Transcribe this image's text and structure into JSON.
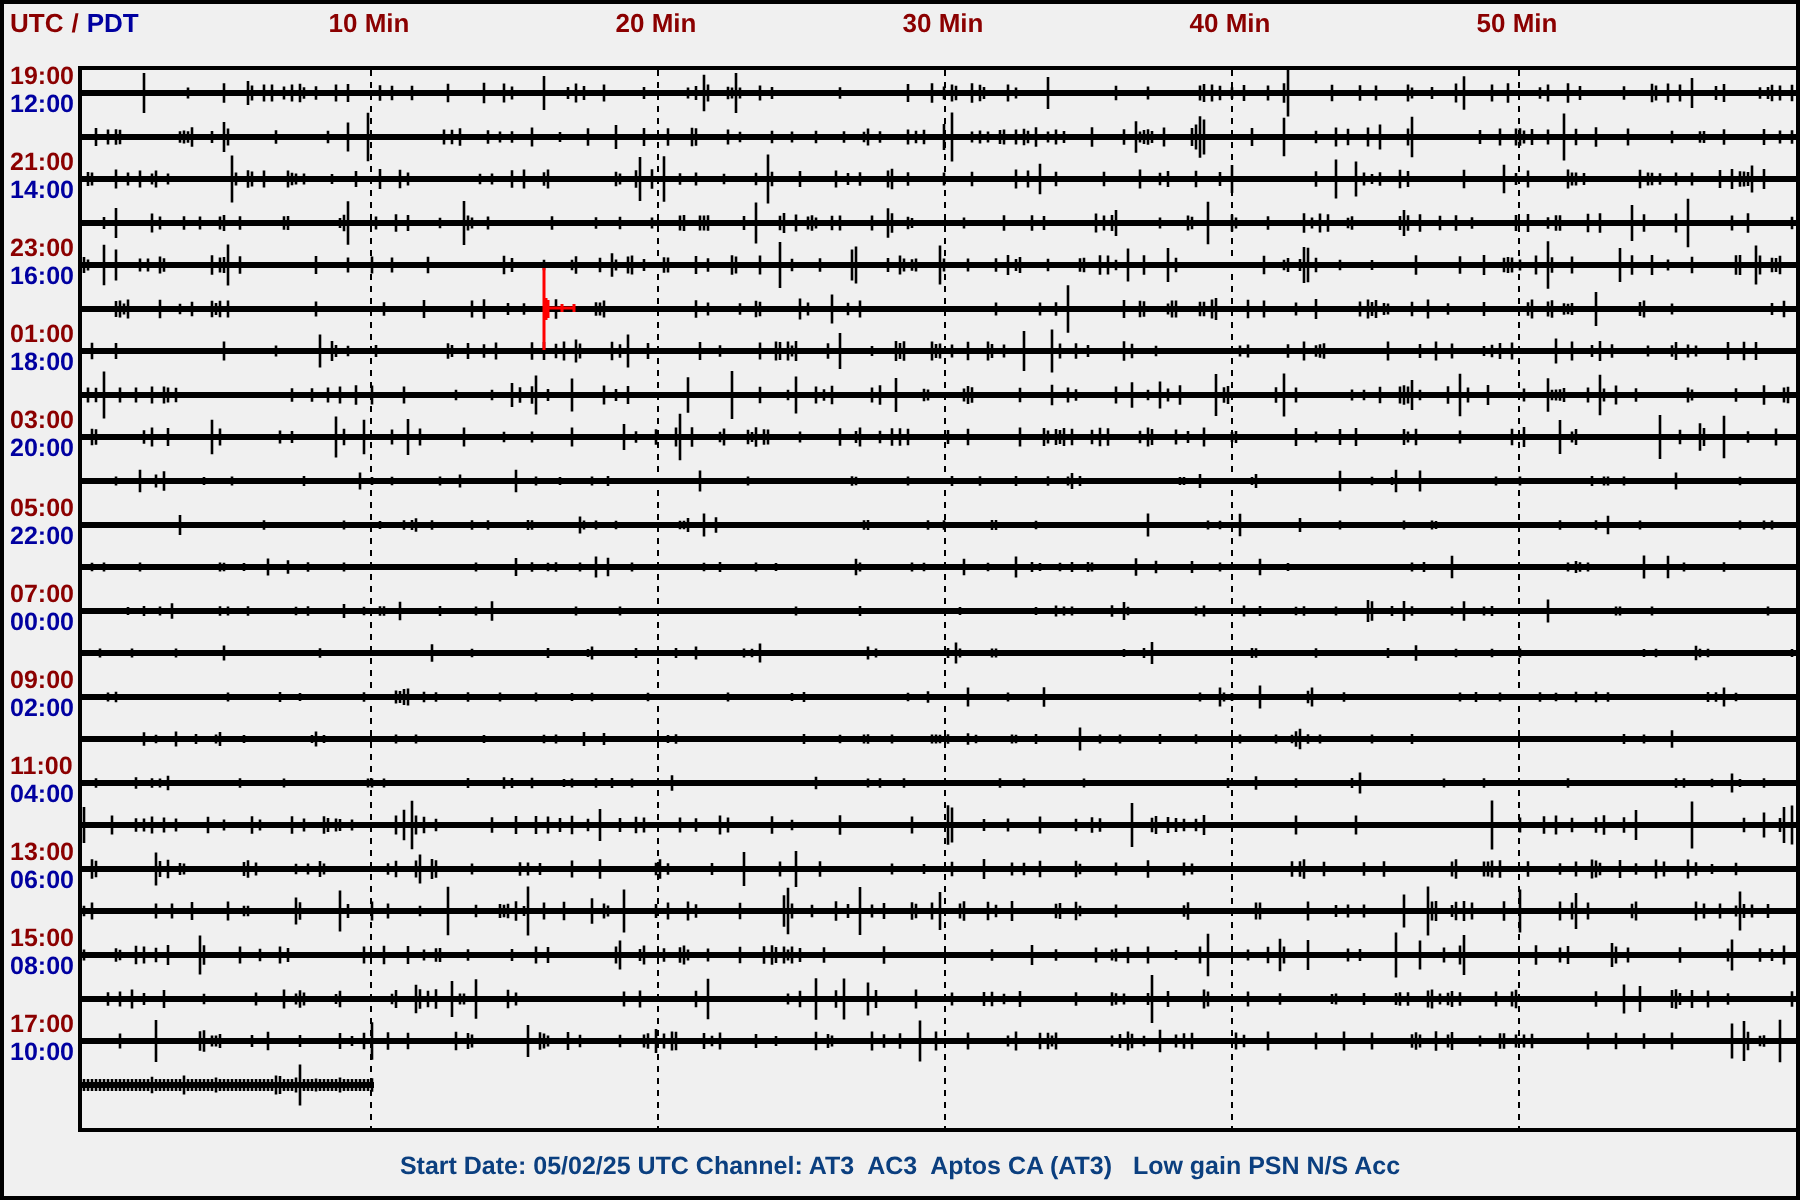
{
  "header": {
    "utc_label": "UTC",
    "separator": "/",
    "local_label": "PDT"
  },
  "minute_ticks": [
    "10 Min",
    "20 Min",
    "30 Min",
    "40 Min",
    "50 Min"
  ],
  "time_labels": [
    {
      "utc": "19:00",
      "local": "12:00"
    },
    {
      "utc": "21:00",
      "local": "14:00"
    },
    {
      "utc": "23:00",
      "local": "16:00"
    },
    {
      "utc": "01:00",
      "local": "18:00"
    },
    {
      "utc": "03:00",
      "local": "20:00"
    },
    {
      "utc": "05:00",
      "local": "22:00"
    },
    {
      "utc": "07:00",
      "local": "00:00"
    },
    {
      "utc": "09:00",
      "local": "02:00"
    },
    {
      "utc": "11:00",
      "local": "04:00"
    },
    {
      "utc": "13:00",
      "local": "06:00"
    },
    {
      "utc": "15:00",
      "local": "08:00"
    },
    {
      "utc": "17:00",
      "local": "10:00"
    }
  ],
  "caption": "Start Date: 05/02/25 UTC Channel: AT3  AC3  Aptos CA (AT3)   Low gain PSN N/S Acc"
}
